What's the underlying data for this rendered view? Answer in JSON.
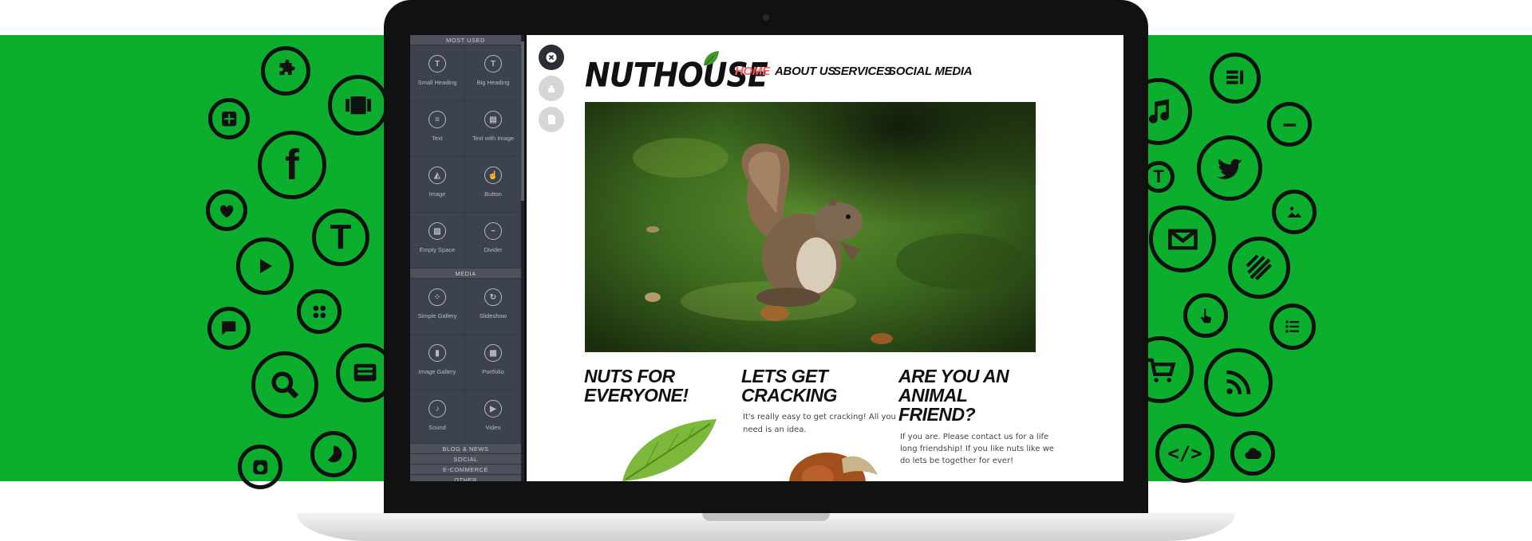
{
  "builder": {
    "sections": {
      "most_used": "MOST USED",
      "media": "MEDIA",
      "blog_news": "BLOG & NEWS",
      "social": "SOCIAL",
      "ecommerce": "E-COMMERCE",
      "other": "OTHER"
    },
    "elements": {
      "small_heading": {
        "label": "Small Heading",
        "icon": "small-heading-icon"
      },
      "big_heading": {
        "label": "Big Heading",
        "icon": "big-heading-icon"
      },
      "text": {
        "label": "Text",
        "icon": "text-icon"
      },
      "text_with_image": {
        "label": "Text with Image",
        "icon": "text-with-image-icon"
      },
      "image": {
        "label": "Image",
        "icon": "image-icon"
      },
      "button": {
        "label": "Button",
        "icon": "button-icon"
      },
      "empty_space": {
        "label": "Empty Space",
        "icon": "empty-space-icon"
      },
      "divider": {
        "label": "Divider",
        "icon": "divider-icon"
      },
      "simple_gallery": {
        "label": "Simple Gallery",
        "icon": "simple-gallery-icon"
      },
      "slideshow": {
        "label": "Slideshow",
        "icon": "slideshow-icon"
      },
      "image_gallery": {
        "label": "Image Gallery",
        "icon": "image-gallery-icon"
      },
      "portfolio": {
        "label": "Portfolio",
        "icon": "portfolio-icon"
      },
      "sound": {
        "label": "Sound",
        "icon": "sound-icon"
      },
      "video": {
        "label": "Video",
        "icon": "video-icon"
      }
    },
    "controls": [
      "close-icon",
      "theme-icon",
      "page-icon"
    ]
  },
  "site": {
    "logo": "NUTHOUSE",
    "nav": {
      "home": "HOME",
      "about": "ABOUT US",
      "services": "SERVICES",
      "social": "SOCIAL MEDIA"
    },
    "active_nav_color": "#ff5a5a",
    "columns": {
      "c1": {
        "title_l1": "NUTS FOR",
        "title_l2": "EVERYONE!"
      },
      "c2": {
        "title_l1": "LETS GET",
        "title_l2": "CRACKING",
        "text_l1": "It's really easy to get cracking! All you",
        "text_l2": "need is an idea."
      },
      "c3": {
        "title_l1": "ARE YOU AN",
        "title_l2": "ANIMAL",
        "title_l3": "FRIEND?",
        "text_l1": "If you are. Please contact us for a life",
        "text_l2": "long friendship! If you like nuts like we",
        "text_l3": "do lets be together for ever!"
      }
    }
  },
  "background_icons": [
    "puzzle-icon",
    "gallery-circle-icon",
    "plus-icon",
    "facebook-icon",
    "heart-icon",
    "text-t-icon",
    "play-icon",
    "grid-icon",
    "comment-icon",
    "search-icon",
    "news-icon",
    "instagram-icon",
    "pie-chart-icon",
    "article-icon",
    "music-icon",
    "minus-icon",
    "twitter-icon",
    "text-small-icon",
    "image-icon",
    "mail-icon",
    "stripes-icon",
    "pointer-icon",
    "list-icon",
    "cart-icon",
    "rss-icon",
    "code-icon",
    "cloud-icon"
  ],
  "colors": {
    "brand_green": "#0cae2e",
    "panel": "#3c434e",
    "ink": "#111111"
  }
}
